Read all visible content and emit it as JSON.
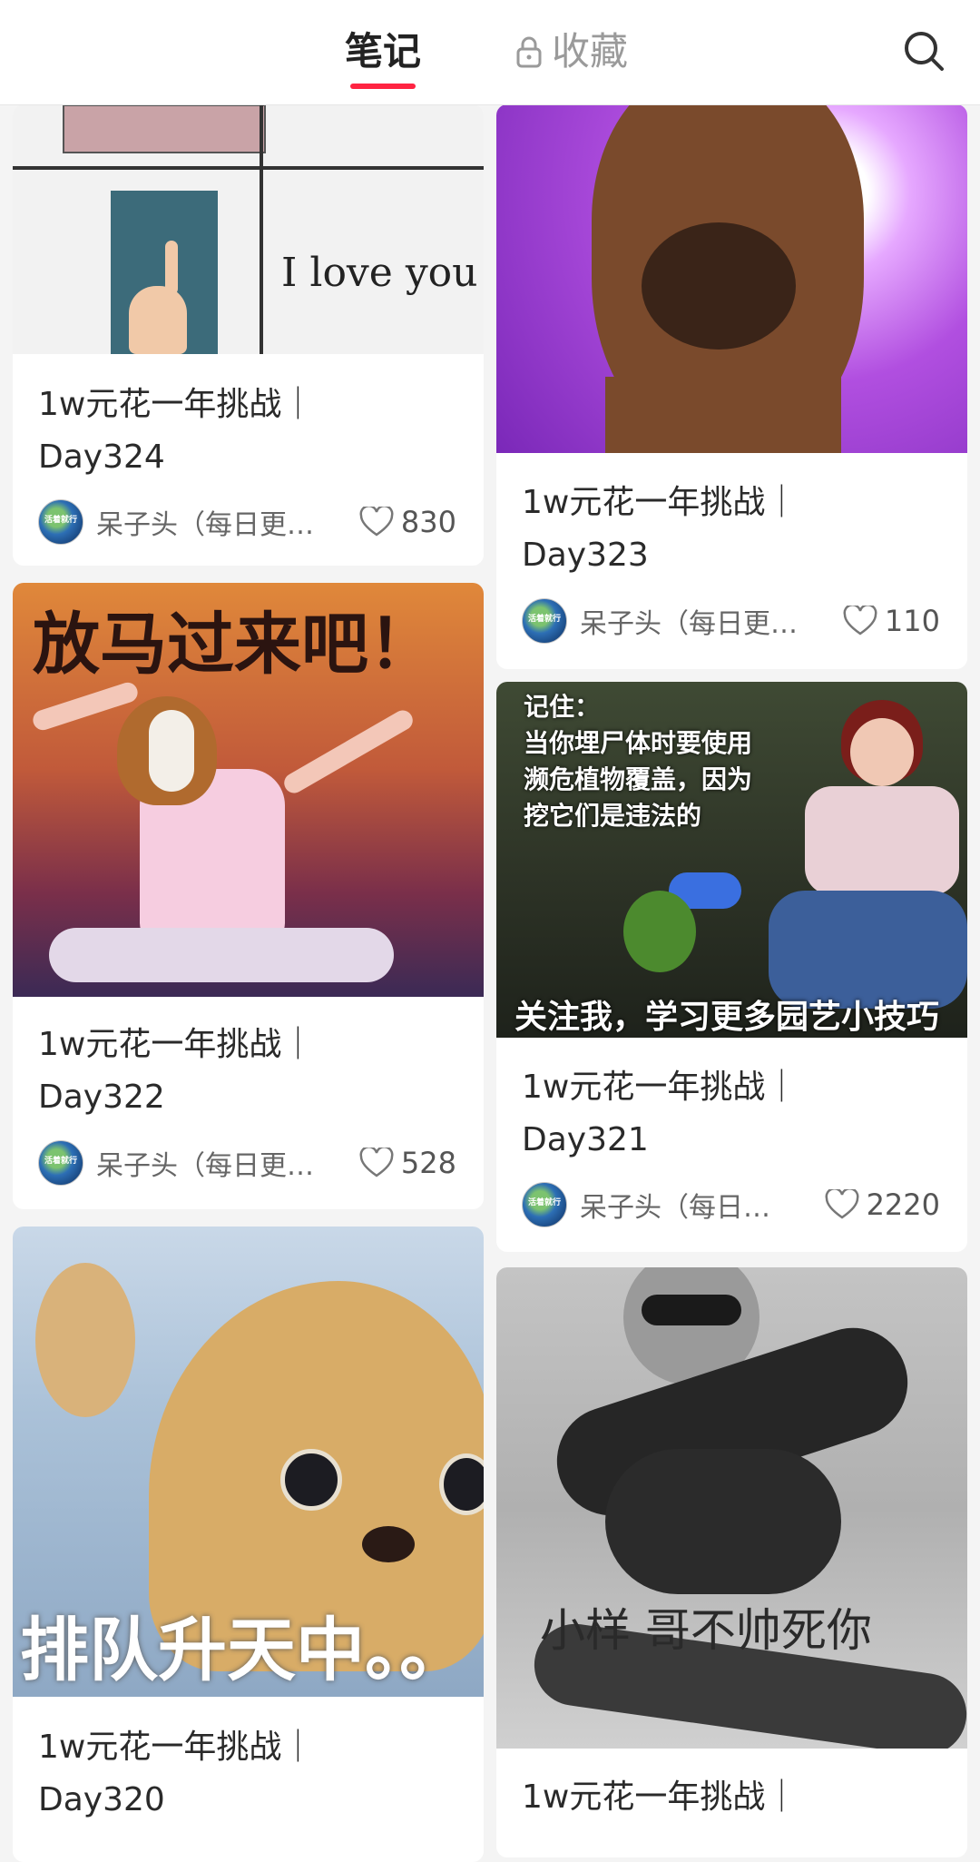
{
  "header": {
    "tab_notes": "笔记",
    "tab_favorites": "收藏"
  },
  "cards": [
    {
      "title": "1w元花一年挑战｜\nDay324",
      "author": "呆子头（每日更…",
      "likes": "830",
      "image_text": "I love you"
    },
    {
      "title": "1w元花一年挑战｜\nDay323",
      "author": "呆子头（每日更…",
      "likes": "110"
    },
    {
      "title": "1w元花一年挑战｜\nDay322",
      "author": "呆子头（每日更…",
      "likes": "528",
      "image_text": "放马过来吧！"
    },
    {
      "title": "1w元花一年挑战｜\nDay321",
      "author": "呆子头（每日…",
      "likes": "2220",
      "image_text_top": "记住：\n当你埋尸体时要使用\n濒危植物覆盖，因为\n挖它们是违法的",
      "image_text_bottom": "关注我，学习更多园艺小技巧"
    },
    {
      "title": "1w元花一年挑战｜\nDay320",
      "image_text": "排队升天中。。"
    },
    {
      "title": "1w元花一年挑战｜",
      "image_text": "小样 哥不帅死你"
    }
  ],
  "avatar_text": "活着就行",
  "colors": {
    "accent": "#ff2442",
    "background": "#f4f4f4"
  }
}
